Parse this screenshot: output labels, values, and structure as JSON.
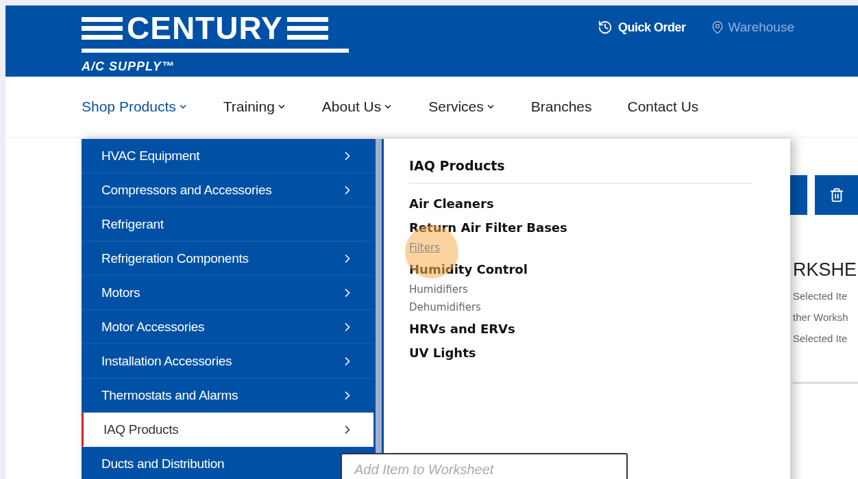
{
  "header": {
    "logo_title": "CENTURY",
    "logo_subtitle": "A/C SUPPLY™",
    "quick_order": "Quick Order",
    "warehouse": "Warehouse"
  },
  "nav": [
    {
      "label": "Shop Products",
      "dropdown": true,
      "selected": true
    },
    {
      "label": "Training",
      "dropdown": true,
      "selected": false
    },
    {
      "label": "About Us",
      "dropdown": true,
      "selected": false
    },
    {
      "label": "Services",
      "dropdown": true,
      "selected": false
    },
    {
      "label": "Branches",
      "dropdown": false,
      "selected": false
    },
    {
      "label": "Contact Us",
      "dropdown": false,
      "selected": false
    }
  ],
  "menu": [
    {
      "label": "HVAC Equipment",
      "submenu": true,
      "selected": false
    },
    {
      "label": "Compressors and Accessories",
      "submenu": true,
      "selected": false
    },
    {
      "label": "Refrigerant",
      "submenu": false,
      "selected": false
    },
    {
      "label": "Refrigeration Components",
      "submenu": true,
      "selected": false
    },
    {
      "label": "Motors",
      "submenu": true,
      "selected": false
    },
    {
      "label": "Motor Accessories",
      "submenu": true,
      "selected": false
    },
    {
      "label": "Installation Accessories",
      "submenu": true,
      "selected": false
    },
    {
      "label": "Thermostats and Alarms",
      "submenu": true,
      "selected": false
    },
    {
      "label": "IAQ Products",
      "submenu": true,
      "selected": true
    },
    {
      "label": "Ducts and Distribution",
      "submenu": false,
      "selected": false
    }
  ],
  "submenu": {
    "title": "IAQ Products",
    "items": [
      {
        "label": "Air Cleaners",
        "kind": "category",
        "selected": false
      },
      {
        "label": "Return Air Filter Bases",
        "kind": "category",
        "selected": false
      },
      {
        "label": "Filters",
        "kind": "sub",
        "selected": true
      },
      {
        "label": "Humidity Control",
        "kind": "category",
        "selected": false
      },
      {
        "label": "Humidifiers",
        "kind": "sub",
        "selected": false
      },
      {
        "label": "Dehumidifiers",
        "kind": "sub",
        "selected": false
      },
      {
        "label": "HRVs and ERVs",
        "kind": "category",
        "selected": false
      },
      {
        "label": "UV Lights",
        "kind": "category",
        "selected": false
      }
    ]
  },
  "background": {
    "heading": "RKSHE",
    "lines": [
      "Selected Ite",
      "ther Worksh",
      "Selected Ite"
    ]
  },
  "item_field": {
    "placeholder": "Add Item to Worksheet"
  }
}
